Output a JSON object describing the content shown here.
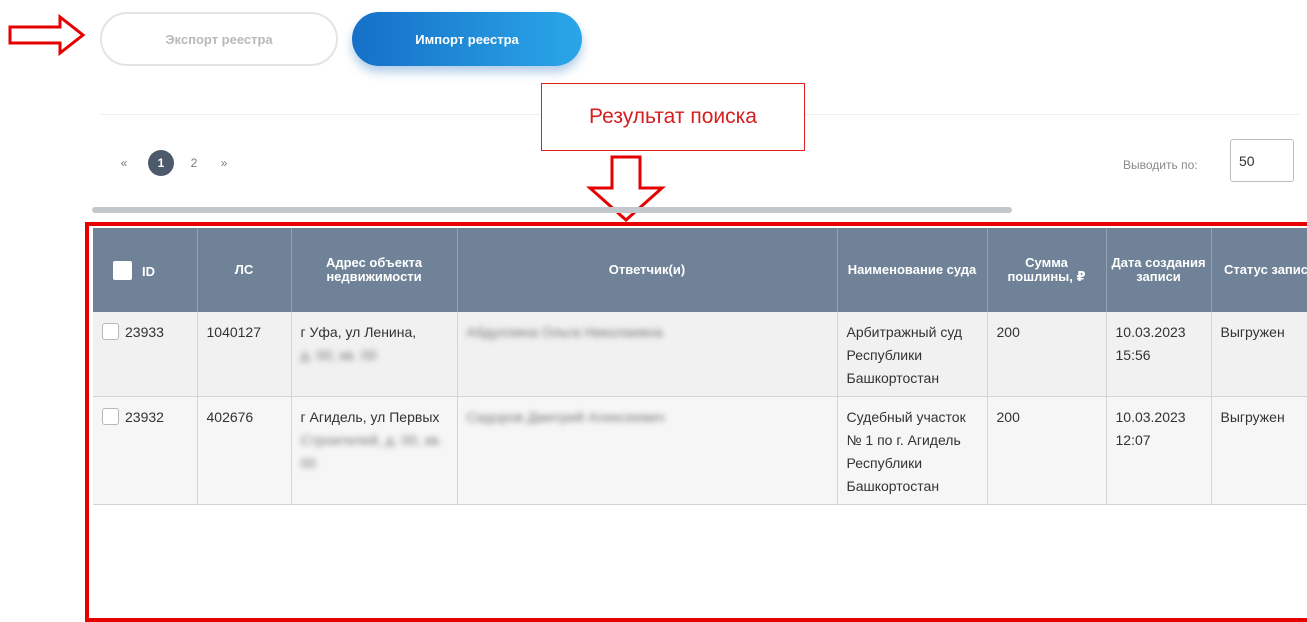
{
  "toolbar": {
    "export_label": "Экспорт реестра",
    "import_label": "Импорт реестра"
  },
  "annotation": {
    "search_result_label": "Результат поиска",
    "color": "#e60000"
  },
  "pagination": {
    "prev": "«",
    "pages": [
      "1",
      "2"
    ],
    "current_page": "1",
    "next": "»"
  },
  "per_page": {
    "label": "Выводить по:",
    "value": "50"
  },
  "table": {
    "columns": [
      "ID",
      "ЛС",
      "Адрес объекта недвижимости",
      "Ответчик(и)",
      "Наименование суда",
      "Сумма пошлины, ₽",
      "Дата создания записи",
      "Статус записи"
    ],
    "rows": [
      {
        "id": "23933",
        "ls": "1040127",
        "address_visible": "г Уфа, ул Ленина,",
        "address_hidden": "д. 00, кв. 00",
        "respondent_hidden": "Абдуллина Ольга Николаевна",
        "court": "Арбитражный суд Республики Башкортостан",
        "fee": "200",
        "created_date": "10.03.2023",
        "created_time": "15:56",
        "status": "Выгружен"
      },
      {
        "id": "23932",
        "ls": "402676",
        "address_visible": "г Агидель, ул Первых",
        "address_hidden": "Строителей, д. 00, кв. 00",
        "respondent_hidden": "Сидоров Дмитрий Алексеевич",
        "court": "Судебный участок № 1 по г. Агидель Республики Башкортостан",
        "fee": "200",
        "created_date": "10.03.2023",
        "created_time": "12:07",
        "status": "Выгружен"
      }
    ]
  },
  "colors": {
    "header_bg": "#6f8297",
    "import_gradient_start": "#1670c7",
    "import_gradient_end": "#2aa6e8",
    "active_page": "#4c5a6b"
  }
}
